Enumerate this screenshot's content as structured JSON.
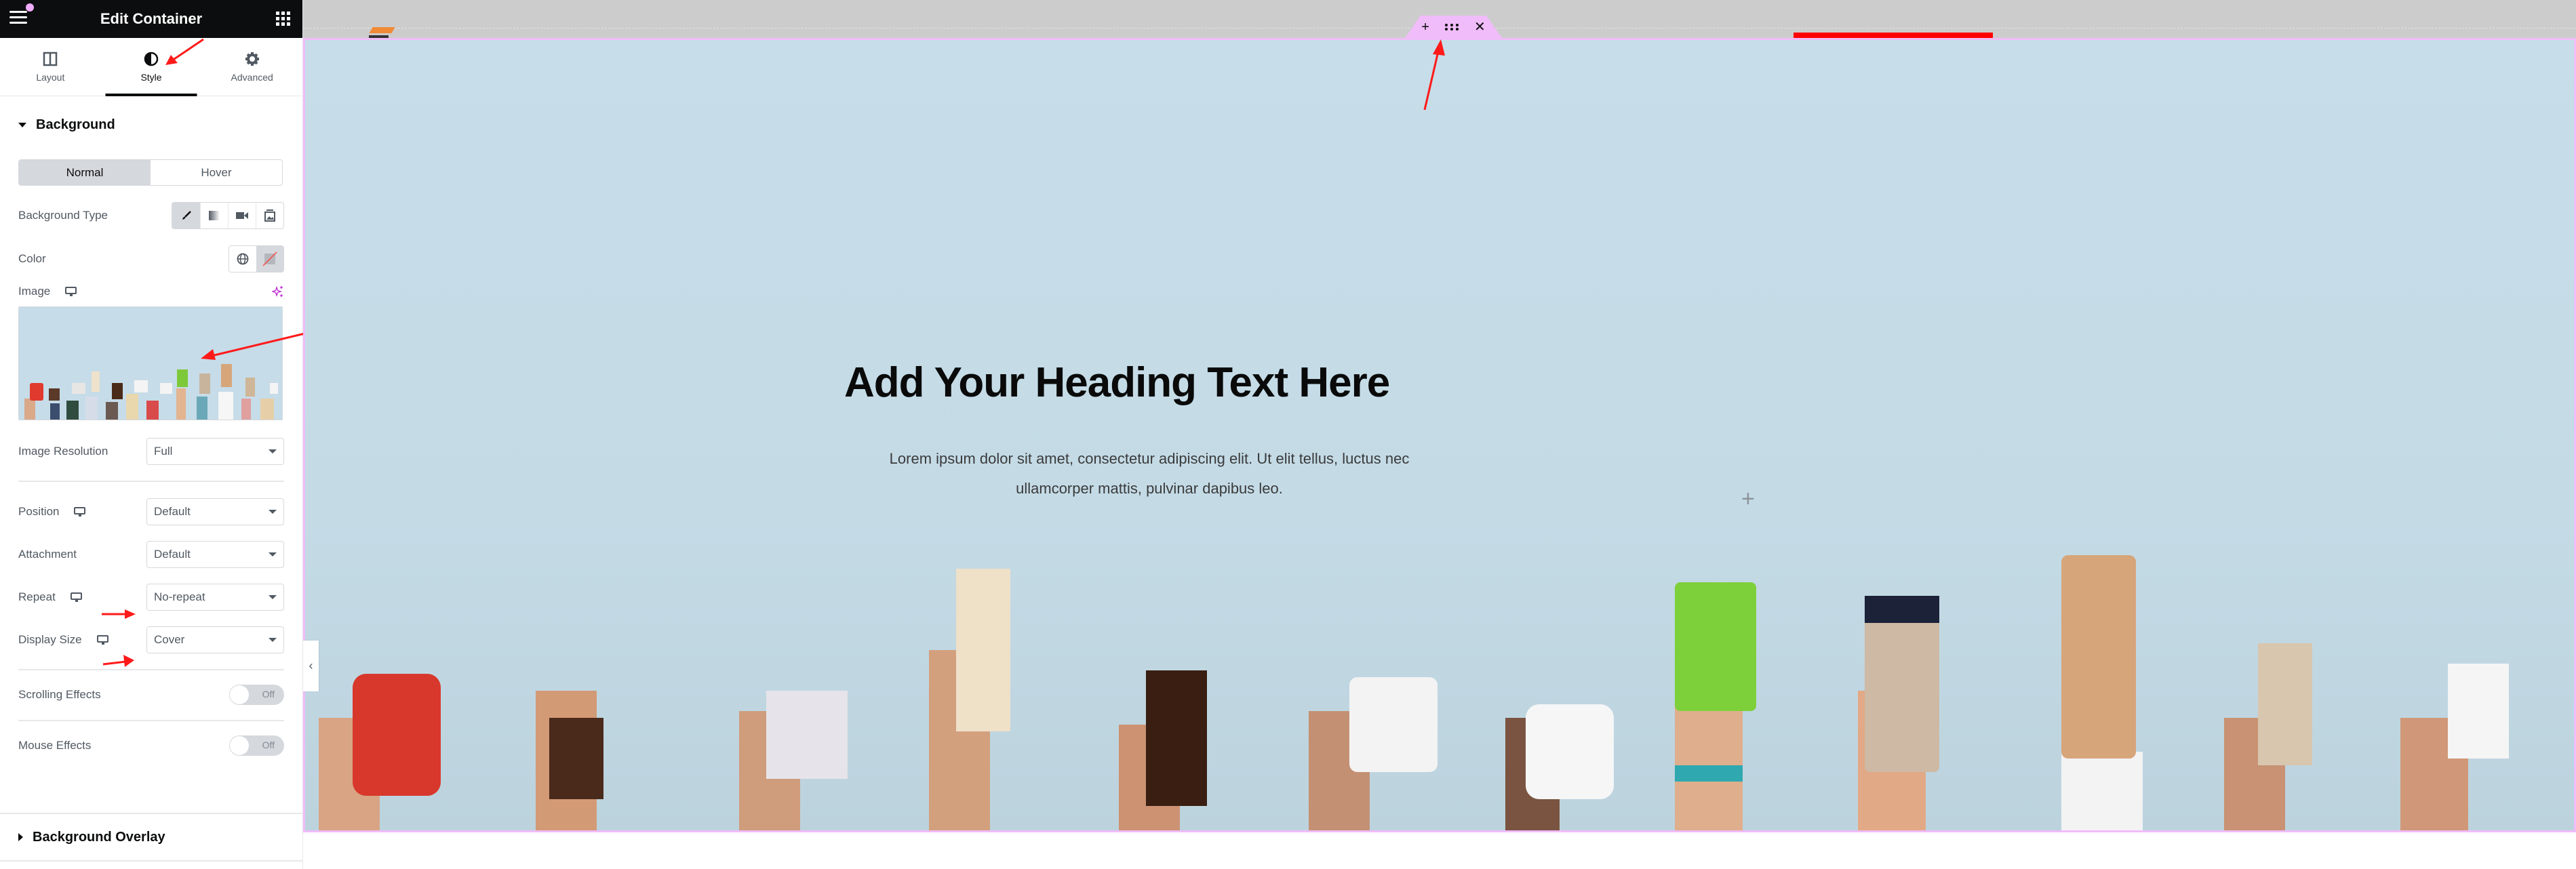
{
  "panel": {
    "title": "Edit Container",
    "tabs": [
      {
        "label": "Layout",
        "icon": "layout-columns-icon",
        "active": false
      },
      {
        "label": "Style",
        "icon": "half-circle-contrast-icon",
        "active": true
      },
      {
        "label": "Advanced",
        "icon": "gear-icon",
        "active": false
      }
    ],
    "background_section": {
      "title": "Background",
      "state_tabs": [
        {
          "label": "Normal",
          "active": true
        },
        {
          "label": "Hover",
          "active": false
        }
      ],
      "background_type_label": "Background Type",
      "background_type_options": [
        "classic-brush-icon",
        "gradient-icon",
        "video-icon",
        "slideshow-icon"
      ],
      "background_type_selected": "classic-brush-icon",
      "color_label": "Color",
      "image_label": "Image",
      "image_resolution_label": "Image Resolution",
      "image_resolution_value": "Full",
      "position_label": "Position",
      "position_value": "Default",
      "attachment_label": "Attachment",
      "attachment_value": "Default",
      "repeat_label": "Repeat",
      "repeat_value": "No-repeat",
      "display_size_label": "Display Size",
      "display_size_value": "Cover",
      "scrolling_effects_label": "Scrolling Effects",
      "scrolling_effects_state": "Off",
      "mouse_effects_label": "Mouse Effects",
      "mouse_effects_state": "Off"
    },
    "overlay_section": {
      "title": "Background Overlay"
    }
  },
  "canvas": {
    "heading": "Add Your Heading Text Here",
    "paragraph": "Lorem ipsum dolor sit amet, consectetur adipiscing elit. Ut elit tellus, luctus nec ullamcorper mattis, pulvinar dapibus leo.",
    "handle": {
      "add": "+",
      "drag": "⋮⋮⋮",
      "close": "✕"
    },
    "add_element": "+"
  },
  "colors": {
    "accent_pink": "#f0bcf9",
    "ai_magenta": "#c026d3",
    "annotation_red": "#ff0000",
    "hero_bg": "#c7dde9"
  }
}
